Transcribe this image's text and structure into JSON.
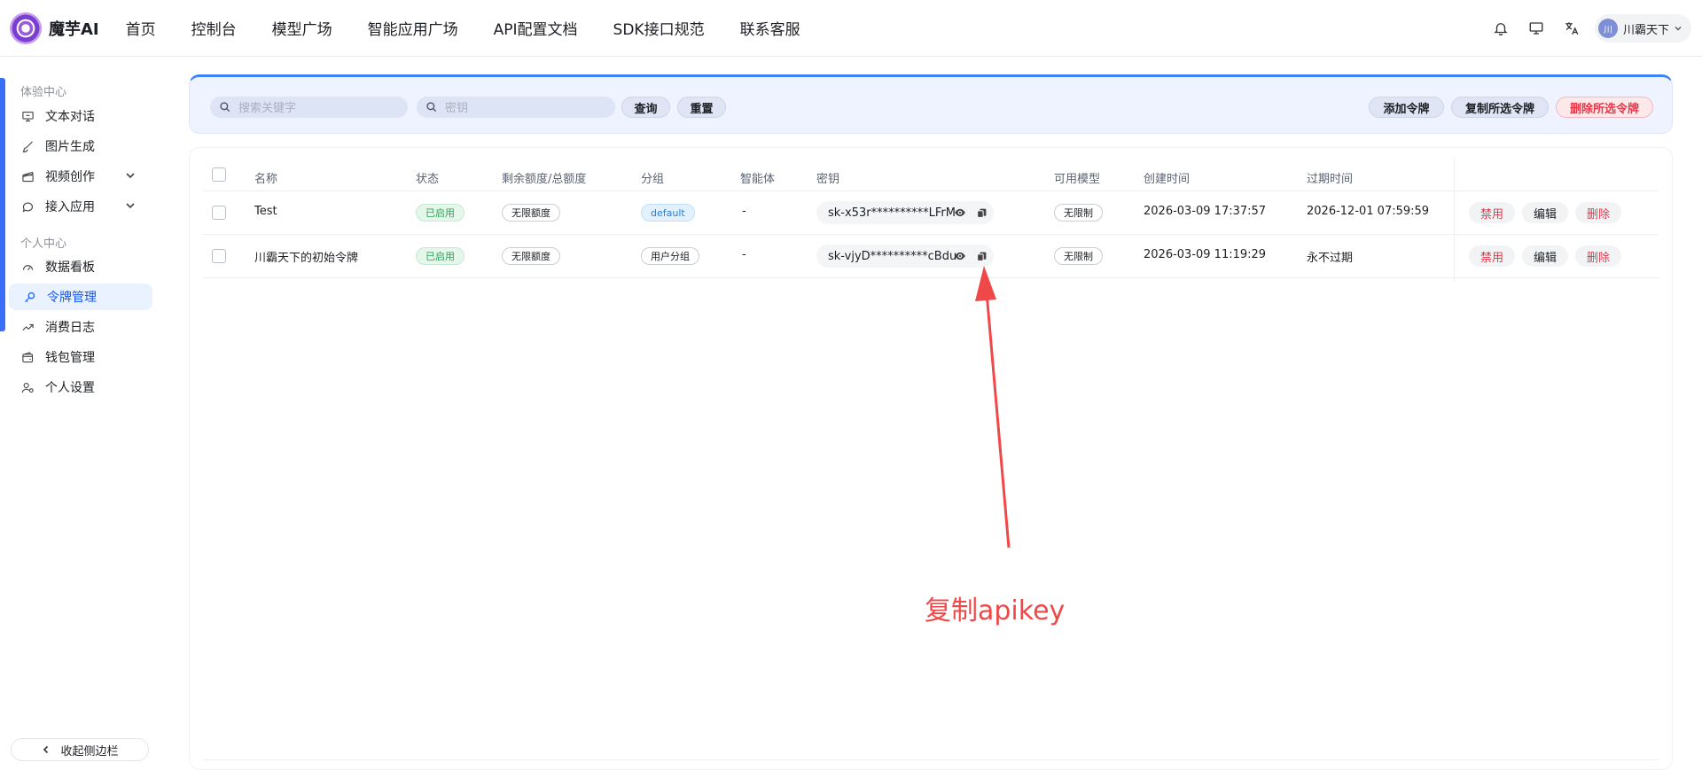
{
  "header": {
    "logo_text": "魔芋AI",
    "nav": [
      "首页",
      "控制台",
      "模型广场",
      "智能应用广场",
      "API配置文档",
      "SDK接口规范",
      "联系客服"
    ],
    "user": {
      "avatar_text": "川",
      "name": "川霸天下"
    }
  },
  "sidebar": {
    "group1": "体验中心",
    "group2": "个人中心",
    "items": [
      {
        "label": "文本对话",
        "icon": "monitor-icon"
      },
      {
        "label": "图片生成",
        "icon": "brush-icon"
      },
      {
        "label": "视频创作",
        "icon": "clapper-icon"
      },
      {
        "label": "接入应用",
        "icon": "chat-bubble-icon"
      },
      {
        "label": "数据看板",
        "icon": "gauge-icon"
      },
      {
        "label": "令牌管理",
        "icon": "key-icon"
      },
      {
        "label": "消费日志",
        "icon": "trend-icon"
      },
      {
        "label": "钱包管理",
        "icon": "wallet-icon"
      },
      {
        "label": "个人设置",
        "icon": "user-settings-icon"
      }
    ],
    "collapse_label": "收起侧边栏"
  },
  "filters": {
    "keyword_placeholder": "搜索关键字",
    "key_placeholder": "密钥",
    "query_label": "查询",
    "reset_label": "重置",
    "add_label": "添加令牌",
    "copy_selected_label": "复制所选令牌",
    "delete_selected_label": "删除所选令牌"
  },
  "table": {
    "columns": [
      "名称",
      "状态",
      "剩余额度/总额度",
      "分组",
      "智能体",
      "密钥",
      "可用模型",
      "创建时间",
      "过期时间"
    ],
    "rows": [
      {
        "name": "Test",
        "status": "已启用",
        "quota": "无限额度",
        "group": "default",
        "agent": "-",
        "key": "sk-x53r**********LFrM",
        "models": "无限制",
        "created": "2026-03-09 17:37:57",
        "expires": "2026-12-01 07:59:59",
        "actions": [
          "禁用",
          "编辑",
          "删除"
        ]
      },
      {
        "name": "川霸天下的初始令牌",
        "status": "已启用",
        "quota": "无限额度",
        "group": "用户分组",
        "agent": "-",
        "key": "sk-vjyD**********cBdu",
        "models": "无限制",
        "created": "2026-03-09 11:19:29",
        "expires": "永不过期",
        "actions": [
          "禁用",
          "编辑",
          "删除"
        ]
      }
    ]
  },
  "annotation": {
    "text": "复制apikey",
    "color": "#f04848"
  }
}
